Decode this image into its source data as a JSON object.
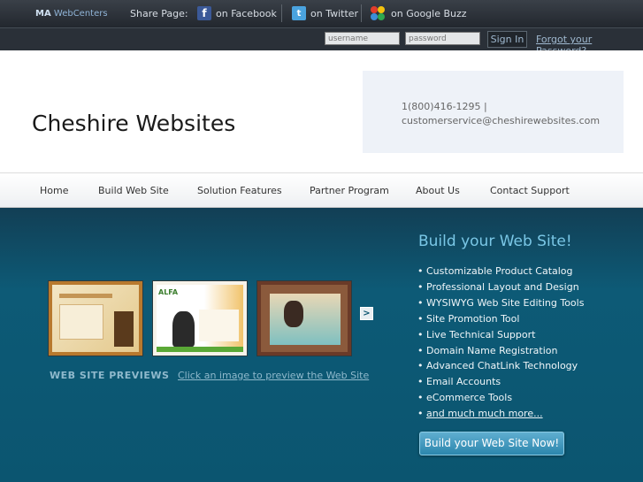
{
  "topbar": {
    "brand_bold": "MA",
    "brand_rest": "WebCenters",
    "share_label": "Share Page:",
    "facebook": "on Facebook",
    "twitter": "on Twitter",
    "buzz": "on Google Buzz"
  },
  "login": {
    "username_placeholder": "username",
    "password_placeholder": "password",
    "signin": "Sign In",
    "forgot": "Forgot your Password?"
  },
  "header": {
    "site_title": "Cheshire Websites",
    "phone": "1(800)416-1295 |",
    "email": "customerservice@cheshirewebsites.com"
  },
  "nav": [
    "Home",
    "Build Web Site",
    "Solution Features",
    "Partner Program",
    "About Us",
    "Contact Support"
  ],
  "previews": {
    "label": "WEB SITE PREVIEWS",
    "link": "Click an image to preview the Web Site",
    "next": ">"
  },
  "build": {
    "title": "Build your Web Site!",
    "features": [
      "Customizable Product Catalog",
      "Professional Layout and Design",
      "WYSIWYG Web Site Editing Tools",
      "Site Promotion Tool",
      "Live Technical Support",
      "Domain Name Registration",
      "Advanced ChatLink Technology",
      "Email Accounts",
      "eCommerce Tools"
    ],
    "more": "and much much more...",
    "cta": "Build your Web Site Now!"
  },
  "colors": {
    "teal_bg": "#0b5570",
    "accent_title": "#7ac7e6",
    "dark_bar": "#2a3038"
  }
}
